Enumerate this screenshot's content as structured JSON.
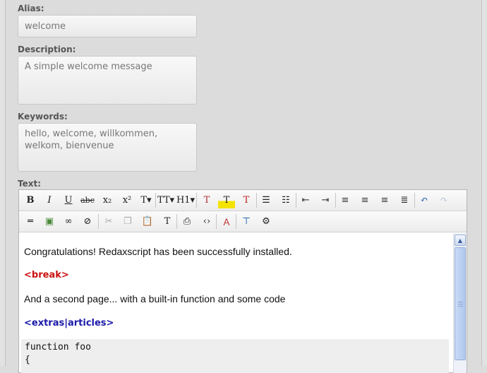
{
  "form": {
    "alias_label": "Alias:",
    "alias_value": "welcome",
    "description_label": "Description:",
    "description_value": "A simple welcome message",
    "keywords_label": "Keywords:",
    "keywords_value": "hello, welcome, willkommen, welkom, bienvenue",
    "text_label": "Text:"
  },
  "toolbar_row1": [
    {
      "glyph": "B",
      "icon": "bold-icon"
    },
    {
      "glyph": "I",
      "icon": "italic-icon"
    },
    {
      "glyph": "U",
      "icon": "underline-icon"
    },
    {
      "glyph": "abc",
      "icon": "strikethrough-icon"
    },
    {
      "glyph": "x₂",
      "icon": "subscript-icon"
    },
    {
      "glyph": "x²",
      "icon": "superscript-icon"
    },
    {
      "glyph": "T▾",
      "icon": "font-family-icon"
    },
    {
      "glyph": "TT▾",
      "icon": "font-size-icon"
    },
    {
      "glyph": "H1▾",
      "icon": "heading-icon"
    },
    {
      "glyph": "T",
      "icon": "text-color-icon"
    },
    {
      "glyph": "T",
      "icon": "highlight-icon"
    },
    {
      "glyph": "T",
      "icon": "clear-format-icon"
    },
    {
      "glyph": "☰",
      "icon": "bullet-list-icon"
    },
    {
      "glyph": "☷",
      "icon": "numbered-list-icon"
    },
    {
      "glyph": "⇤",
      "icon": "outdent-icon"
    },
    {
      "glyph": "⇥",
      "icon": "indent-icon"
    },
    {
      "glyph": "≡",
      "icon": "align-left-icon"
    },
    {
      "glyph": "≡",
      "icon": "align-center-icon"
    },
    {
      "glyph": "≡",
      "icon": "align-right-icon"
    },
    {
      "glyph": "≣",
      "icon": "align-justify-icon"
    },
    {
      "glyph": "↶",
      "icon": "undo-icon"
    },
    {
      "glyph": "↷",
      "icon": "redo-icon"
    }
  ],
  "toolbar_row2": [
    {
      "glyph": "═",
      "icon": "horizontal-rule-icon"
    },
    {
      "glyph": "▣",
      "icon": "insert-image-icon"
    },
    {
      "glyph": "∞",
      "icon": "insert-link-icon"
    },
    {
      "glyph": "⊘",
      "icon": "unlink-icon"
    },
    {
      "glyph": "✂",
      "icon": "cut-icon"
    },
    {
      "glyph": "❐",
      "icon": "copy-icon"
    },
    {
      "glyph": "📋",
      "icon": "paste-icon"
    },
    {
      "glyph": "T",
      "icon": "paste-text-icon"
    },
    {
      "glyph": "⎙",
      "icon": "print-icon"
    },
    {
      "glyph": "‹›",
      "icon": "source-code-icon"
    },
    {
      "glyph": "Ａ",
      "icon": "spellcheck-icon"
    },
    {
      "glyph": "⊤",
      "icon": "page-break-icon"
    },
    {
      "glyph": "⚙",
      "icon": "paste-word-icon"
    }
  ],
  "content": {
    "line1": "Congratulations! Redaxscript has been successfully installed.",
    "line2": "<break>",
    "line3": "And a second page... with a built-in function and some code",
    "line4": "<extras|articles>",
    "code": "function foo\n{"
  },
  "colors": {
    "tag_red": "#cc1111",
    "tag_blue": "#1a1aaa",
    "background": "#dcdcdc"
  }
}
